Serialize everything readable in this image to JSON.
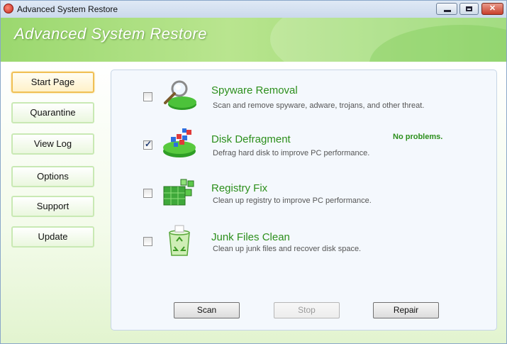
{
  "window": {
    "title": "Advanced System Restore"
  },
  "banner": {
    "title": "Advanced System Restore"
  },
  "nav": {
    "items": [
      {
        "label": "Start Page",
        "active": true
      },
      {
        "label": "Quarantine",
        "active": false
      },
      {
        "label": "View Log",
        "active": false
      },
      {
        "label": "Options",
        "active": false
      },
      {
        "label": "Support",
        "active": false
      },
      {
        "label": "Update",
        "active": false
      }
    ]
  },
  "tasks": [
    {
      "title": "Spyware Removal",
      "desc": "Scan and remove spyware, adware, trojans, and other threat.",
      "checked": false,
      "status": "",
      "icon": "magnifier-icon"
    },
    {
      "title": "Disk Defragment",
      "desc": "Defrag hard disk to improve PC performance.",
      "checked": true,
      "status": "No problems.",
      "icon": "disk-defrag-icon"
    },
    {
      "title": "Registry Fix",
      "desc": "Clean up registry to improve PC performance.",
      "checked": false,
      "status": "",
      "icon": "registry-blocks-icon"
    },
    {
      "title": "Junk Files Clean",
      "desc": "Clean up junk files and recover disk space.",
      "checked": false,
      "status": "",
      "icon": "recycle-bin-icon"
    }
  ],
  "buttons": {
    "scan": "Scan",
    "stop": "Stop",
    "repair": "Repair"
  },
  "colors": {
    "accent_green": "#2c8f1c",
    "banner_green": "#9bd86f",
    "active_nav_border": "#f0c055"
  }
}
